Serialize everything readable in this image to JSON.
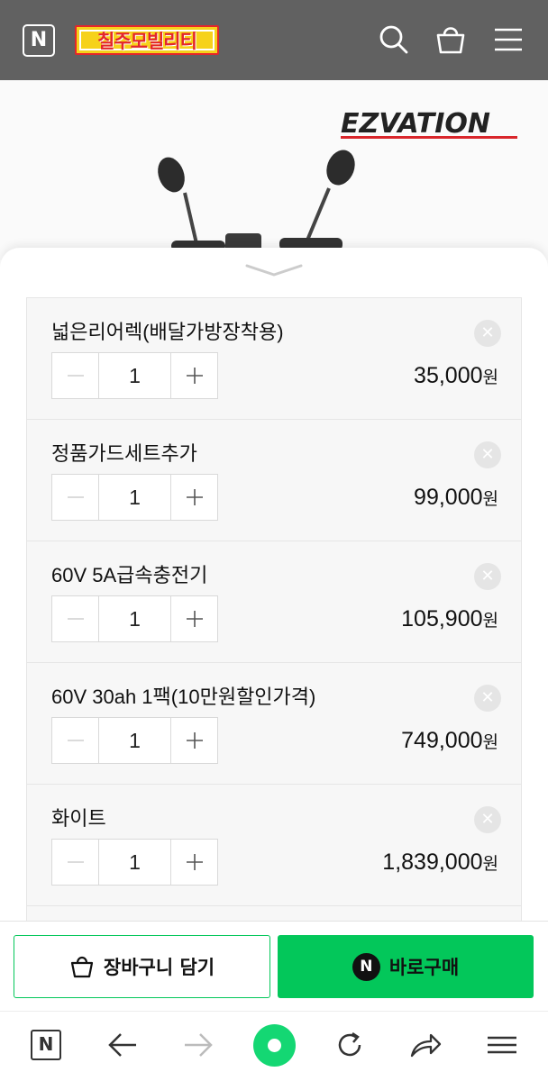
{
  "header": {
    "n_logo_letter": "N",
    "brand_name": "칠주모빌리티",
    "icons": [
      "search-icon",
      "shopping-bag-icon",
      "menu-icon"
    ],
    "background_color": "#616161"
  },
  "hero": {
    "brand_logo_text": "EZVATION"
  },
  "options": [
    {
      "name": "넓은리어렉(배달가방장착용)",
      "quantity": "1",
      "price": "35,000",
      "unit": "원"
    },
    {
      "name": "정품가드세트추가",
      "quantity": "1",
      "price": "99,000",
      "unit": "원"
    },
    {
      "name": "60V 5A급속충전기",
      "quantity": "1",
      "price": "105,900",
      "unit": "원"
    },
    {
      "name": "60V 30ah 1팩(10만원할인가격)",
      "quantity": "1",
      "price": "749,000",
      "unit": "원"
    },
    {
      "name": "화이트",
      "quantity": "1",
      "price": "1,839,000",
      "unit": "원"
    }
  ],
  "buttons": {
    "cart_label": "장바구니 담기",
    "buy_label": "바로구매",
    "buy_badge": "N",
    "accent_color": "#03c75a"
  },
  "browser_nav": {
    "n_logo_letter": "N",
    "icons": [
      "back-arrow-icon",
      "forward-arrow-icon",
      "home-dot-icon",
      "refresh-icon",
      "share-icon",
      "menu-icon"
    ]
  }
}
